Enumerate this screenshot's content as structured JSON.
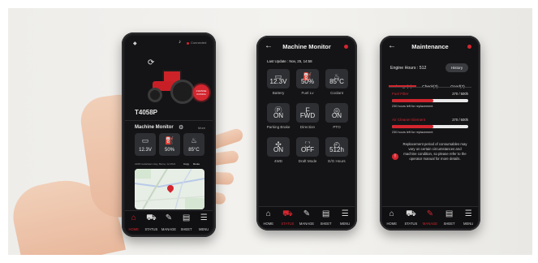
{
  "colors": {
    "accent": "#d3262f",
    "screen_bg": "#141416",
    "tile_bg": "#2e2f33"
  },
  "phone1": {
    "status_connected": "Connected",
    "model": "T4058P",
    "badge": "CHANGE CONFIG",
    "monitor_title": "Machine Monitor",
    "more": "More",
    "tiles": [
      {
        "icon": "battery-icon",
        "value": "12.3V"
      },
      {
        "icon": "fuel-icon",
        "value": "50%"
      },
      {
        "icon": "coolant-icon",
        "value": "85°C"
      }
    ],
    "address": "2108 Cedarlawn Hwy, Berne, Gt 2521",
    "copy": "Copy",
    "route": "Route"
  },
  "phone2": {
    "title": "Machine Monitor",
    "last_update": "Last Update : Nov, 25, 14:58",
    "tiles": [
      {
        "icon": "battery-icon",
        "value": "12.3V",
        "label": "Battery"
      },
      {
        "icon": "fuel-icon",
        "value": "50%",
        "label": "Fuel Lv"
      },
      {
        "icon": "coolant-icon",
        "value": "85°C",
        "label": "Coolant"
      },
      {
        "icon": "parking-brake-icon",
        "value": "ON",
        "label": "Parking Brake"
      },
      {
        "icon": "direction-icon",
        "value": "FWD",
        "label": "Direction"
      },
      {
        "icon": "pto-icon",
        "value": "ON",
        "label": "PTO"
      },
      {
        "icon": "awd-icon",
        "value": "ON",
        "label": "4WD"
      },
      {
        "icon": "draft-mode-icon",
        "value": "OFF",
        "label": "Draft Mode"
      },
      {
        "icon": "engine-hours-icon",
        "value": "512h",
        "label": "E/G Hours"
      }
    ]
  },
  "phone3": {
    "title": "Maintenance",
    "engine_hours": "Engine Hours : 512",
    "history": "History",
    "tabs": [
      "Change(3)",
      "Check(3)",
      "Good(2)"
    ],
    "items": [
      {
        "name": "Fuel Filter",
        "ratio": "270 / 500h",
        "left": "230 hours left for replacement",
        "fraction": 0.54
      },
      {
        "name": "Air Cleaner Element",
        "ratio": "270 / 500h",
        "left": "230 hours left for replacement",
        "fraction": 0.54
      }
    ],
    "notice": "Replacement period of consumables may vary on certain circumstances and machine condition, so please refer to the operator manual for more details."
  },
  "nav": [
    {
      "icon": "home-icon",
      "label": "HOME"
    },
    {
      "icon": "tractor-icon",
      "label": "STATUS"
    },
    {
      "icon": "wrench-icon",
      "label": "MANAGE"
    },
    {
      "icon": "sheet-icon",
      "label": "SHEET"
    },
    {
      "icon": "menu-icon",
      "label": "MENU"
    }
  ]
}
